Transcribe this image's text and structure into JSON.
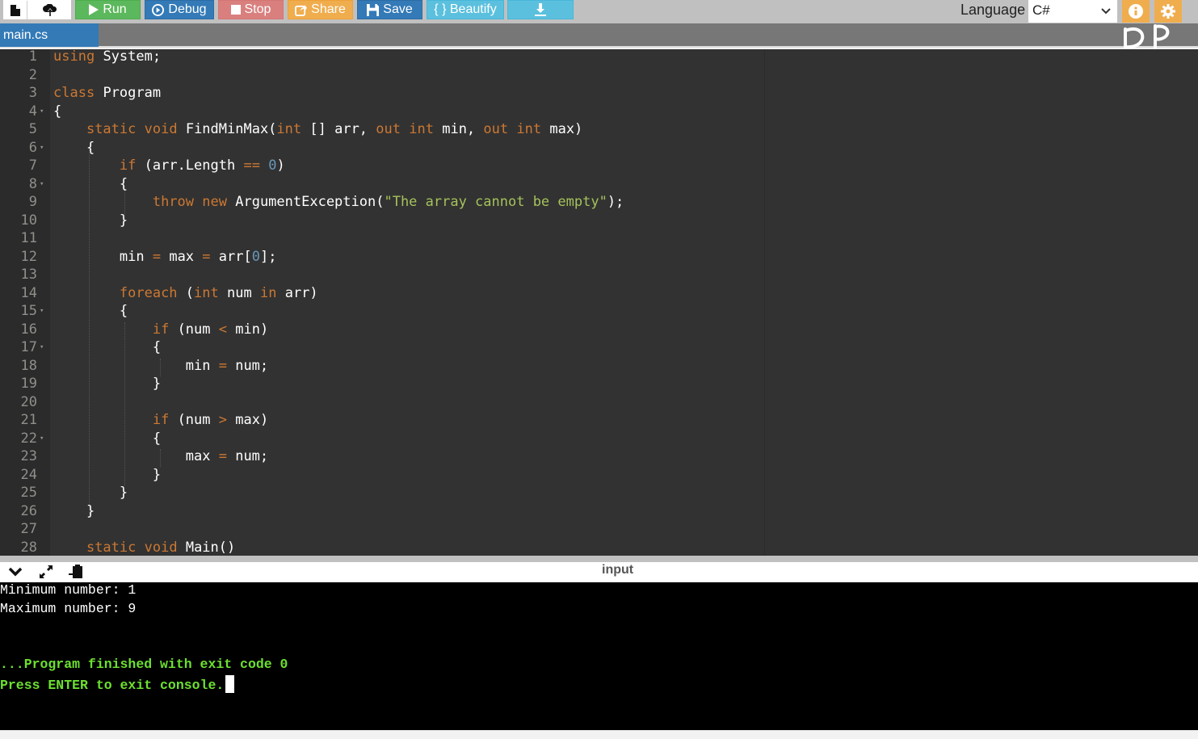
{
  "toolbar": {
    "buttons": {
      "new_file": "new-file-icon",
      "upload": "upload-icon",
      "run": "Run",
      "debug": "Debug",
      "stop": "Stop",
      "share": "Share",
      "save": "Save",
      "beautify": "{ } Beautify",
      "download": "download-icon"
    },
    "language_label": "Language",
    "language_value": "C#"
  },
  "tabs": [
    {
      "label": "main.cs",
      "active": true
    }
  ],
  "overlay_annotation": "DP",
  "editor": {
    "lines": [
      {
        "n": "1",
        "fold": false
      },
      {
        "n": "2",
        "fold": false
      },
      {
        "n": "3",
        "fold": false
      },
      {
        "n": "4",
        "fold": true
      },
      {
        "n": "5",
        "fold": false
      },
      {
        "n": "6",
        "fold": true
      },
      {
        "n": "7",
        "fold": false
      },
      {
        "n": "8",
        "fold": true
      },
      {
        "n": "9",
        "fold": false
      },
      {
        "n": "10",
        "fold": false
      },
      {
        "n": "11",
        "fold": false
      },
      {
        "n": "12",
        "fold": false
      },
      {
        "n": "13",
        "fold": false
      },
      {
        "n": "14",
        "fold": false
      },
      {
        "n": "15",
        "fold": true
      },
      {
        "n": "16",
        "fold": false
      },
      {
        "n": "17",
        "fold": true
      },
      {
        "n": "18",
        "fold": false
      },
      {
        "n": "19",
        "fold": false
      },
      {
        "n": "20",
        "fold": false
      },
      {
        "n": "21",
        "fold": false
      },
      {
        "n": "22",
        "fold": true
      },
      {
        "n": "23",
        "fold": false
      },
      {
        "n": "24",
        "fold": false
      },
      {
        "n": "25",
        "fold": false
      },
      {
        "n": "26",
        "fold": false
      },
      {
        "n": "27",
        "fold": false
      },
      {
        "n": "28",
        "fold": false
      }
    ],
    "code": [
      [
        [
          "kw",
          "using"
        ],
        [
          "",
          "System;"
        ]
      ],
      [],
      [
        [
          "kw",
          "class"
        ],
        [
          "",
          "Program"
        ]
      ],
      [
        [
          "",
          "{"
        ]
      ],
      [
        [
          "",
          "    "
        ],
        [
          "kw",
          "static"
        ],
        [
          "kw",
          "void"
        ],
        [
          "",
          "FindMinMax("
        ],
        [
          "kw",
          "int"
        ],
        [
          "",
          "[] arr, "
        ],
        [
          "kw",
          "out"
        ],
        [
          "kw",
          "int"
        ],
        [
          "",
          "min, "
        ],
        [
          "kw",
          "out"
        ],
        [
          "kw",
          "int"
        ],
        [
          "",
          "max)"
        ]
      ],
      [
        [
          "",
          "    {"
        ]
      ],
      [
        [
          "",
          "        "
        ],
        [
          "kw",
          "if"
        ],
        [
          "",
          "(arr.Length "
        ],
        [
          "op",
          "=="
        ],
        [
          "num",
          "0"
        ],
        [
          "",
          ")"
        ]
      ],
      [
        [
          "",
          "        {"
        ]
      ],
      [
        [
          "",
          "            "
        ],
        [
          "kw",
          "throw"
        ],
        [
          "kw",
          "new"
        ],
        [
          "",
          "ArgumentException("
        ],
        [
          "str",
          "\"The array cannot be empty\""
        ],
        [
          "",
          ");"
        ]
      ],
      [
        [
          "",
          "        }"
        ]
      ],
      [],
      [
        [
          "",
          "        min "
        ],
        [
          "op",
          "="
        ],
        [
          "",
          "max "
        ],
        [
          "op",
          "="
        ],
        [
          "",
          "arr["
        ],
        [
          "num",
          "0"
        ],
        [
          "",
          "];"
        ]
      ],
      [],
      [
        [
          "",
          "        "
        ],
        [
          "kw",
          "foreach"
        ],
        [
          "",
          "("
        ],
        [
          "kw",
          "int"
        ],
        [
          "",
          "num "
        ],
        [
          "kw",
          "in"
        ],
        [
          "",
          "arr)"
        ]
      ],
      [
        [
          "",
          "        {"
        ]
      ],
      [
        [
          "",
          "            "
        ],
        [
          "kw",
          "if"
        ],
        [
          "",
          "(num "
        ],
        [
          "op",
          "<"
        ],
        [
          "",
          "min)"
        ]
      ],
      [
        [
          "",
          "            {"
        ]
      ],
      [
        [
          "",
          "                min "
        ],
        [
          "op",
          "="
        ],
        [
          "",
          "num;"
        ]
      ],
      [
        [
          "",
          "            }"
        ]
      ],
      [],
      [
        [
          "",
          "            "
        ],
        [
          "kw",
          "if"
        ],
        [
          "",
          "(num "
        ],
        [
          "op",
          ">"
        ],
        [
          "",
          "max)"
        ]
      ],
      [
        [
          "",
          "            {"
        ]
      ],
      [
        [
          "",
          "                max "
        ],
        [
          "op",
          "="
        ],
        [
          "",
          "num;"
        ]
      ],
      [
        [
          "",
          "            }"
        ]
      ],
      [
        [
          "",
          "        }"
        ]
      ],
      [
        [
          "",
          "    }"
        ]
      ],
      [],
      [
        [
          "",
          "    "
        ],
        [
          "kw",
          "static"
        ],
        [
          "kw",
          "void"
        ],
        [
          "",
          "Main()"
        ]
      ]
    ]
  },
  "console": {
    "title": "input",
    "icons": [
      "chevron-down-icon",
      "expand-icon",
      "copy-paste-icon"
    ],
    "output": [
      {
        "text": "Minimum number: 1",
        "style": "white"
      },
      {
        "text": "Maximum number: 9",
        "style": "white"
      },
      {
        "text": "",
        "style": "white"
      },
      {
        "text": "",
        "style": "white"
      },
      {
        "text": "...Program finished with exit code 0",
        "style": "green"
      },
      {
        "text": "Press ENTER to exit console.",
        "style": "green",
        "cursor": true
      }
    ]
  }
}
